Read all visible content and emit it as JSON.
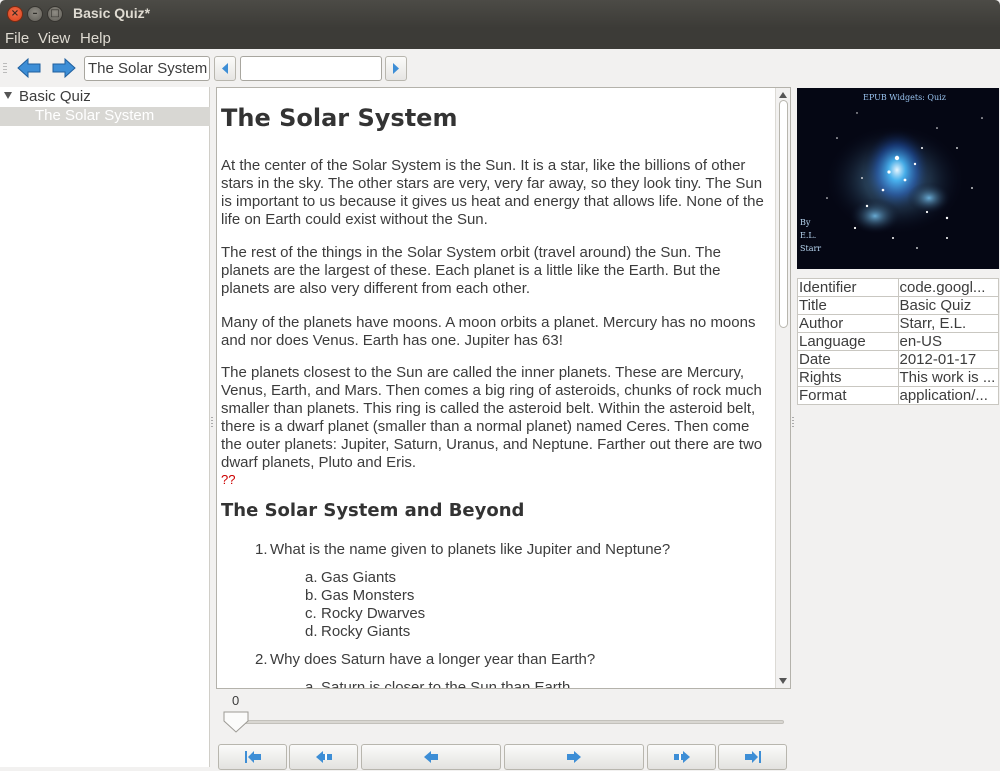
{
  "window": {
    "title": "Basic Quiz*"
  },
  "menu": [
    "File",
    "View",
    "Help"
  ],
  "toolbar": {
    "location": "The Solar System",
    "search_value": ""
  },
  "tree": {
    "root": "Basic Quiz",
    "child": "The Solar System"
  },
  "content": {
    "title": "The Solar System",
    "paragraphs": [
      "At the center of the Solar System is the Sun. It is a star, like the billions of other stars in the sky. The other stars are very, very far away, so they look tiny. The Sun is important to us because it gives us heat and energy that allows life. None of the life on Earth could exist without the Sun.",
      "The rest of the things in the Solar System orbit (travel around) the Sun. The planets are the largest of these. Each planet is a little like the Earth. But the planets are also very different from each other.",
      "Many of the planets have moons. A moon orbits a planet. Mercury has no moons and nor does Venus. Earth has one. Jupiter has 63!",
      "The planets closest to the Sun are called the inner planets. These are Mercury, Venus, Earth, and Mars. Then comes a big ring of asteroids, chunks of rock much smaller than planets. This ring is called the asteroid belt. Within the asteroid belt, there is a dwarf planet (smaller than a normal planet) named Ceres. Then come the outer planets: Jupiter, Saturn, Uranus, and Neptune. Farther out there are two dwarf planets, Pluto and Eris."
    ],
    "missing_marker": "??",
    "subtitle": "The Solar System and Beyond",
    "questions": [
      {
        "num": "1.",
        "text": "What is the name given to planets like Jupiter and Neptune?",
        "options": [
          {
            "letter": "a.",
            "text": "Gas Giants"
          },
          {
            "letter": "b.",
            "text": "Gas Monsters"
          },
          {
            "letter": "c.",
            "text": "Rocky Dwarves"
          },
          {
            "letter": "d.",
            "text": "Rocky Giants"
          }
        ]
      },
      {
        "num": "2.",
        "text": "Why does Saturn have a longer year than Earth?",
        "options": [
          {
            "letter": "a.",
            "text": "Saturn is closer to the Sun than Earth"
          }
        ]
      }
    ]
  },
  "slider": {
    "value": "0",
    "fraction": 0
  },
  "cover": {
    "title": "EPUB Widgets: Quiz",
    "by": "By",
    "author_line1": "E.L.",
    "author_line2": "Starr"
  },
  "metadata": [
    {
      "key": "Identifier",
      "value": "code.googl..."
    },
    {
      "key": "Title",
      "value": "Basic Quiz"
    },
    {
      "key": "Author",
      "value": "Starr, E.L."
    },
    {
      "key": "Language",
      "value": "en-US"
    },
    {
      "key": "Date",
      "value": "2012-01-17"
    },
    {
      "key": "Rights",
      "value": "This work is ..."
    },
    {
      "key": "Format",
      "value": "application/..."
    }
  ],
  "colors": {
    "accent_arrow": "#3d8ed6",
    "titlebar": "#3c3b37",
    "close_button": "#e2532c"
  }
}
